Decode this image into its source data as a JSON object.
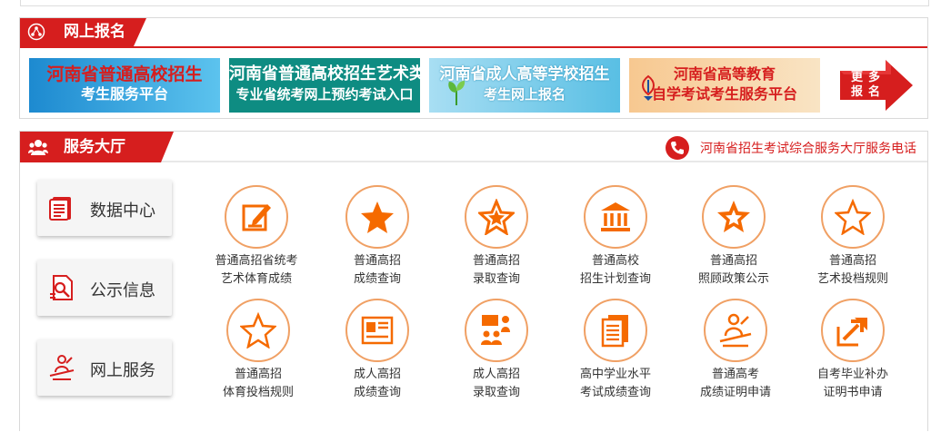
{
  "colors": {
    "accent": "#d61e1e",
    "icon_orange": "#f56a00",
    "circle_border": "#f0a064"
  },
  "online_registration": {
    "title": "网上报名",
    "icon": "network-icon",
    "banners": [
      {
        "line1": "河南省普通高校招生",
        "line2": "考生服务平台"
      },
      {
        "line1": "河南省普通高校招生艺术类",
        "line2": "专业省统考网上预约考试入口"
      },
      {
        "line1": "河南省成人高等学校招生",
        "line2": "考生网上报名"
      },
      {
        "line1": "河南省高等教育",
        "line2": "自学考试考生服务平台"
      }
    ],
    "more_label": "更多报名",
    "more_icon": "arrow-right-icon"
  },
  "service_hall": {
    "title": "服务大厅",
    "icon": "users-icon",
    "phone_text": "河南省招生考试综合服务大厅服务电话",
    "phone_icon": "phone-icon",
    "side_buttons": [
      {
        "label": "数据中心",
        "icon": "document-stack-icon"
      },
      {
        "label": "公示信息",
        "icon": "document-search-icon"
      },
      {
        "label": "网上服务",
        "icon": "person-desk-icon"
      }
    ],
    "services": [
      {
        "line1": "普通高招省统考",
        "line2": "艺术体育成绩",
        "icon": "edit-icon"
      },
      {
        "line1": "普通高招",
        "line2": "成绩查询",
        "icon": "star-filled-icon"
      },
      {
        "line1": "普通高招",
        "line2": "录取查询",
        "icon": "star-badge-icon"
      },
      {
        "line1": "普通高校",
        "line2": "招生计划查询",
        "icon": "institution-icon"
      },
      {
        "line1": "普通高招",
        "line2": "照顾政策公示",
        "icon": "star-medal-icon"
      },
      {
        "line1": "普通高招",
        "line2": "艺术投档规则",
        "icon": "star-outline-icon"
      },
      {
        "line1": "普通高招",
        "line2": "体育投档规则",
        "icon": "star-outline-icon"
      },
      {
        "line1": "成人高招",
        "line2": "成绩查询",
        "icon": "id-card-icon"
      },
      {
        "line1": "成人高招",
        "line2": "录取查询",
        "icon": "presenter-group-icon"
      },
      {
        "line1": "高中学业水平",
        "line2": "考试成绩查询",
        "icon": "document-list-icon"
      },
      {
        "line1": "普通高考",
        "line2": "成绩证明申请",
        "icon": "person-desk-icon"
      },
      {
        "line1": "自考毕业补办",
        "line2": "证明书申请",
        "icon": "export-icon"
      }
    ]
  }
}
